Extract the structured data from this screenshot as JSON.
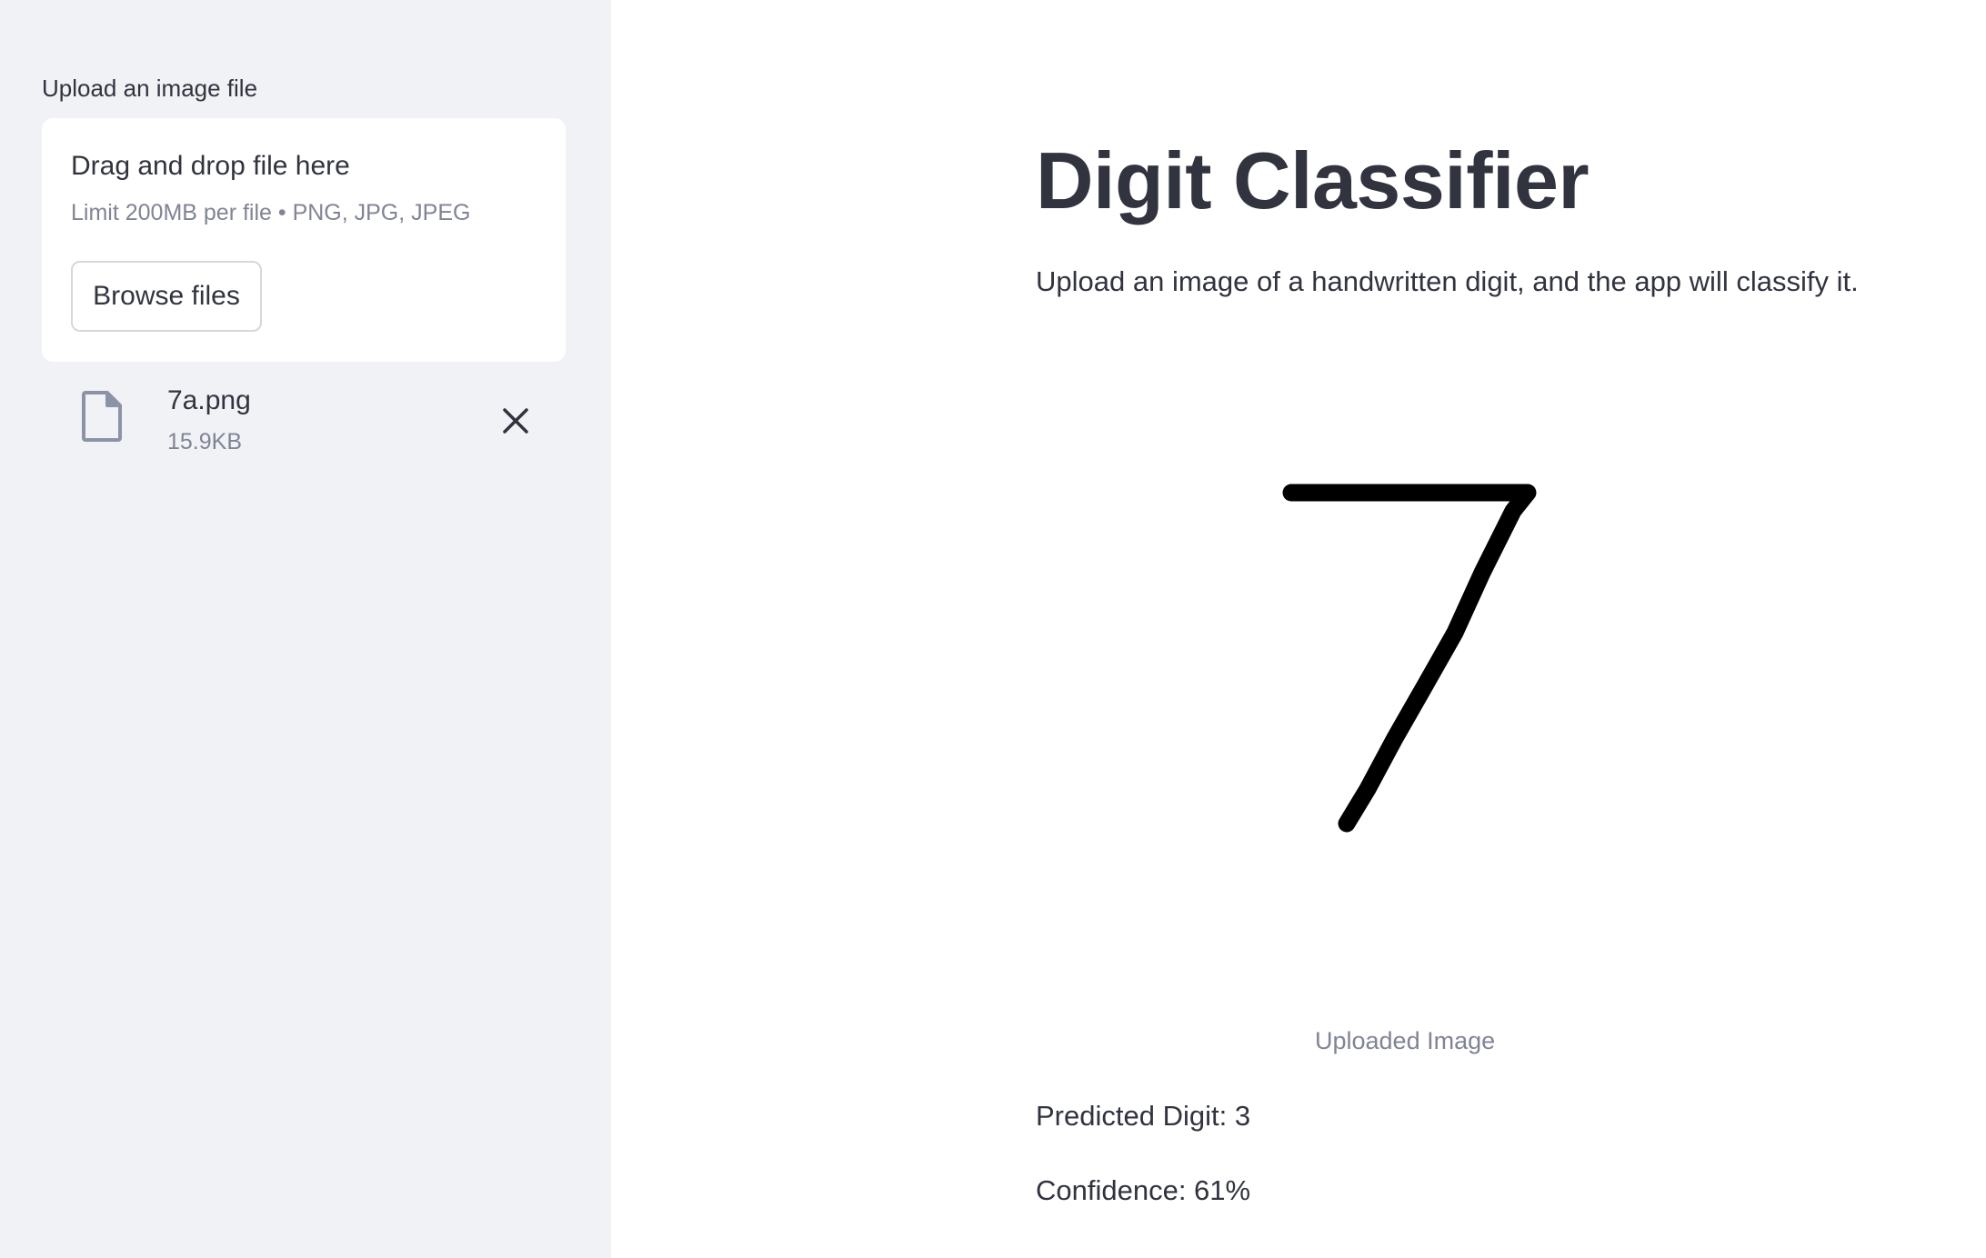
{
  "sidebar": {
    "uploader_label": "Upload an image file",
    "dropzone": {
      "title": "Drag and drop file here",
      "limit_text": "Limit 200MB per file • PNG, JPG, JPEG",
      "browse_label": "Browse files"
    },
    "uploaded_file": {
      "name": "7a.png",
      "size": "15.9KB",
      "icon": "file-icon",
      "remove_icon": "close-icon"
    }
  },
  "main": {
    "title": "Digit Classifier",
    "description": "Upload an image of a handwritten digit, and the app will classify it.",
    "image_caption": "Uploaded Image",
    "prediction_text": "Predicted Digit: 3",
    "confidence_text": "Confidence: 61%"
  },
  "colors": {
    "sidebar_bg": "#f0f2f6",
    "text": "#31333f",
    "muted_text": "#808495"
  }
}
